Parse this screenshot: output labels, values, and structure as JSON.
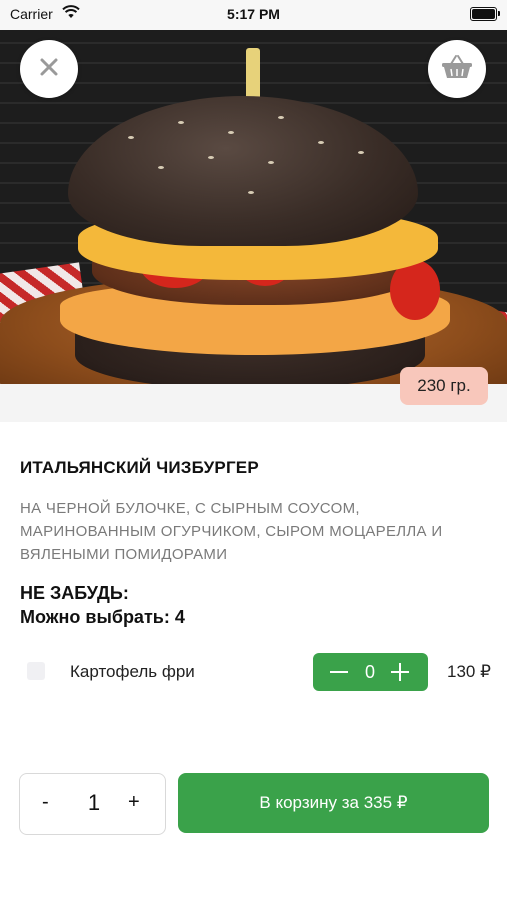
{
  "status_bar": {
    "carrier": "Carrier",
    "time": "5:17 PM"
  },
  "product": {
    "weight": "230 гр.",
    "title": "ИТАЛЬЯНСКИЙ ЧИЗБУРГЕР",
    "description": "НА ЧЕРНОЙ БУЛОЧКЕ, С СЫРНЫМ СОУСОМ, МАРИНОВАННЫМ ОГУРЧИКОМ, СЫРОМ МОЦАРЕЛЛА И ВЯЛЕНЫМИ ПОМИДОРАМИ"
  },
  "addons": {
    "reminder": "НЕ ЗАБУДЬ:",
    "choose_label": "Можно выбрать: 4",
    "items": [
      {
        "label": "Картофель фри",
        "quantity": "0",
        "price": "130 ₽"
      }
    ]
  },
  "footer": {
    "qty_minus": "-",
    "quantity": "1",
    "qty_plus": "+",
    "add_to_cart_label": "В корзину за 335 ₽"
  },
  "icons": {
    "close": "close-icon",
    "cart": "basket-icon",
    "wifi": "wifi-icon",
    "battery": "battery-icon"
  },
  "colors": {
    "accent_green": "#3aa24a",
    "weight_badge": "#f8c7bb"
  }
}
